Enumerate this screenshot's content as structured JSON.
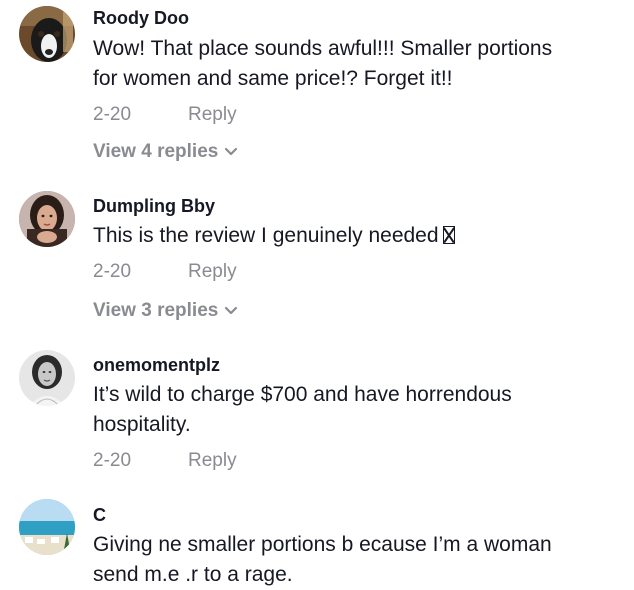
{
  "comments": [
    {
      "username": "Roody Doo",
      "lines": [
        "Wow! That place sounds awful!!! Smaller portions",
        "for women and same price!? Forget it!!"
      ],
      "date": "2-20",
      "reply": "Reply",
      "view_replies": "View 4 replies",
      "avatar_icon": "dog-avatar"
    },
    {
      "username": "Dumpling Bby",
      "lines": [
        "This is the review I genuinely needed"
      ],
      "date": "2-20",
      "reply": "Reply",
      "view_replies": "View 3 replies",
      "avatar_icon": "woman-avatar"
    },
    {
      "username": "onemomentplz",
      "lines": [
        "It’s wild to charge $700 and have horrendous",
        "hospitality."
      ],
      "date": "2-20",
      "reply": "Reply",
      "avatar_icon": "woman-bw-avatar"
    },
    {
      "username": "C",
      "lines": [
        "Giving  ne smaller portions b ecause I’m a woman",
        "send m.e .r to a rage."
      ],
      "avatar_icon": "beach-avatar"
    }
  ],
  "colors": {
    "text": "#161823",
    "secondary": "#8a8b91",
    "background": "#ffffff"
  }
}
